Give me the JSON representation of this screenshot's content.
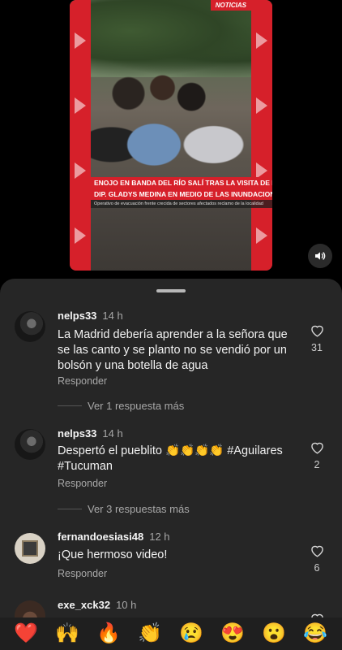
{
  "video": {
    "badge": "NOTICIAS",
    "headline_1": "ENOJO EN BANDA DEL RÍO SALÍ TRAS LA VISITA DE LA",
    "headline_2": "DIP. GLADYS MEDINA EN MEDIO DE LAS INUNDACIONES",
    "subtitle": "Operativo de evacuación frente crecida de sectores afectados reclamo de la localidad"
  },
  "comments": [
    {
      "username": "nelps33",
      "time": "14 h",
      "text": "La Madrid debería aprender a la señora que se las canto y se planto no se vendió por un bolsón y una botella de agua",
      "reply_label": "Responder",
      "likes": "31",
      "more_replies": "Ver 1 respuesta más"
    },
    {
      "username": "nelps33",
      "time": "14 h",
      "text": "Despertó el pueblito 👏👏👏👏 #Aguilares #Tucuman",
      "reply_label": "Responder",
      "likes": "2",
      "more_replies": "Ver 3 respuestas más"
    },
    {
      "username": "fernandoesiasi48",
      "time": "12 h",
      "text": "¡Que hermoso video!",
      "reply_label": "Responder",
      "likes": "6"
    },
    {
      "username": "exe_xck32",
      "time": "10 h"
    }
  ],
  "emoji_bar": [
    "❤️",
    "🙌",
    "🔥",
    "👏",
    "😢",
    "😍",
    "😮",
    "😂"
  ],
  "colors": {
    "sheet_bg": "#262626",
    "video_frame": "#d6202a",
    "muted_text": "#a8a8a8"
  },
  "icons": [
    "volume-icon",
    "heart-outline-icon"
  ]
}
